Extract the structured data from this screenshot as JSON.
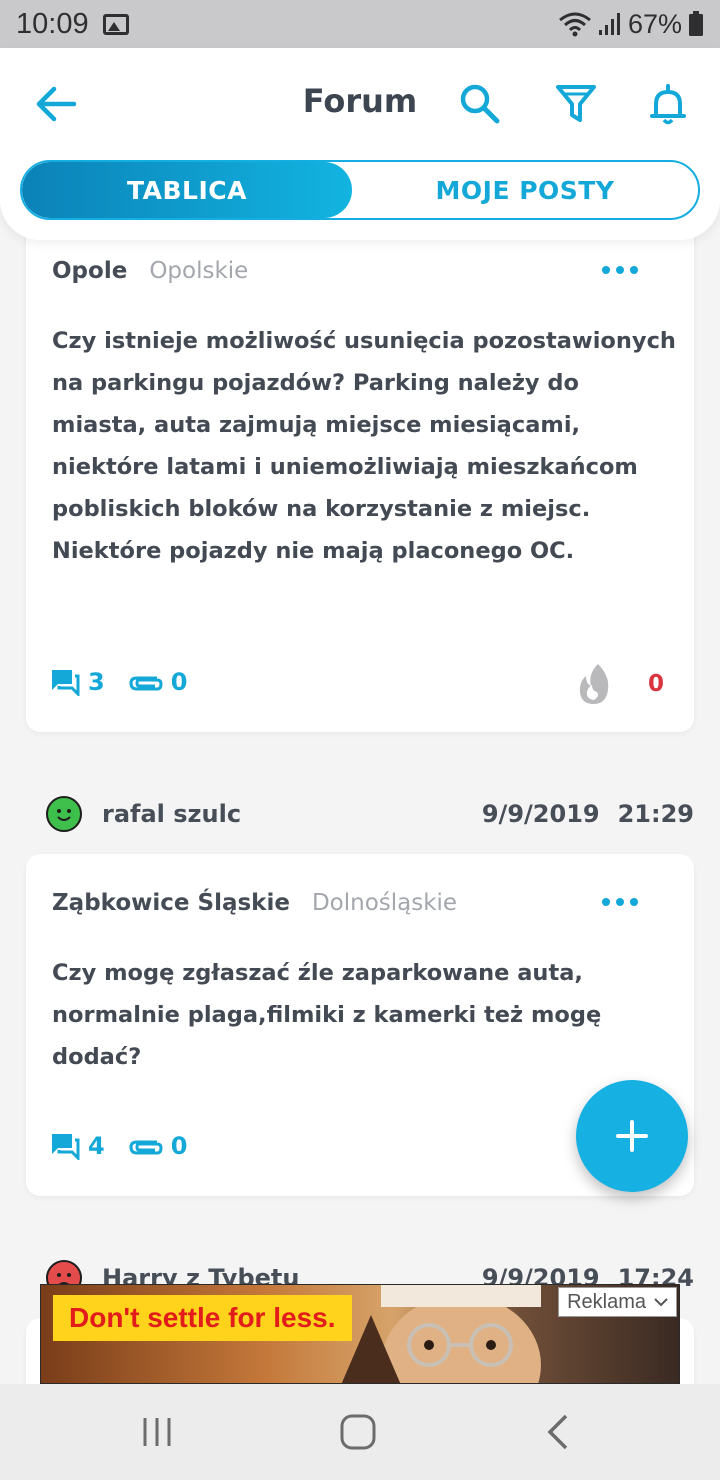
{
  "status_bar": {
    "time": "10:09",
    "battery": "67%"
  },
  "header": {
    "title": "Forum",
    "icons": [
      "back-arrow-icon",
      "search-icon",
      "filter-icon",
      "bell-icon"
    ]
  },
  "tabs": [
    {
      "label": "TABLICA",
      "active": true
    },
    {
      "label": "MOJE POSTY",
      "active": false
    }
  ],
  "posts": [
    {
      "city": "Opole",
      "region": "Opolskie",
      "text": "Czy istnieje możliwość usunięcia pozostawionych na parkingu pojazdów? Parking należy do miasta, auta zajmują miejsce miesiącami, niektóre latami i uniemożliwiają mieszkańcom pobliskich bloków na korzystanie z miejsc. Niektóre pojazdy nie mają placonego OC.",
      "comments": "3",
      "attachments": "0",
      "likes": "0"
    },
    {
      "author": "rafal szulc",
      "date": "9/9/2019",
      "time": "21:29",
      "city": "Ząbkowice Śląskie",
      "region": "Dolnośląskie",
      "text": "Czy mogę zgłaszać źle zaparkowane auta, normalnie plaga,filmiki z kamerki też mogę dodać?",
      "comments": "4",
      "attachments": "0"
    },
    {
      "author": "Harry z Tybetu",
      "date": "9/9/2019",
      "time": "17:24"
    }
  ],
  "ad": {
    "slogan": "Don't settle for less.",
    "badge": "Reklama"
  },
  "colors": {
    "accent": "#14a8d8",
    "like_red": "#d9343f"
  }
}
